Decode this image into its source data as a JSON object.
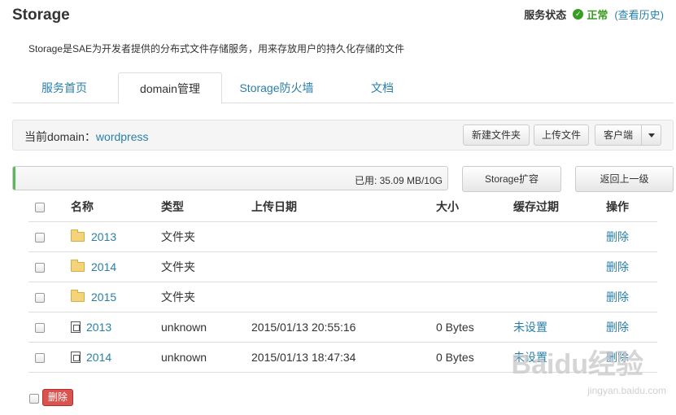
{
  "header": {
    "title": "Storage",
    "status_label": "服务状态",
    "status_value": "正常",
    "status_color": "#3a9d23",
    "history_link": "(查看历史)"
  },
  "description": "Storage是SAE为开发者提供的分布式文件存储服务，用来存放用户的持久化存储的文件",
  "tabs": [
    {
      "label": "服务首页",
      "active": false
    },
    {
      "label": "domain管理",
      "active": true
    },
    {
      "label": "Storage防火墙",
      "active": false
    },
    {
      "label": "文档",
      "active": false
    }
  ],
  "toolbar": {
    "current_label": "当前domain：",
    "current_value": "wordpress",
    "new_folder": "新建文件夹",
    "upload": "上传文件",
    "client": "客户端"
  },
  "usage": {
    "text": "已用: 35.09 MB/10G",
    "fraction": 0.0034,
    "expand_button": "Storage扩容",
    "back_button": "返回上一级"
  },
  "table": {
    "headers": [
      "名称",
      "类型",
      "上传日期",
      "大小",
      "缓存过期",
      "操作"
    ],
    "rows": [
      {
        "icon": "folder-icon",
        "name": "2013",
        "type": "文件夹",
        "date": "",
        "size": "",
        "cache": "",
        "action": "删除"
      },
      {
        "icon": "folder-icon",
        "name": "2014",
        "type": "文件夹",
        "date": "",
        "size": "",
        "cache": "",
        "action": "删除"
      },
      {
        "icon": "folder-icon",
        "name": "2015",
        "type": "文件夹",
        "date": "",
        "size": "",
        "cache": "",
        "action": "删除"
      },
      {
        "icon": "file-icon",
        "name": "2013",
        "type": "unknown",
        "date": "2015/01/13 20:55:16",
        "size": "0 Bytes",
        "cache": "未设置",
        "action": "删除"
      },
      {
        "icon": "file-icon",
        "name": "2014",
        "type": "unknown",
        "date": "2015/01/13 18:47:34",
        "size": "0 Bytes",
        "cache": "未设置",
        "action": "删除"
      }
    ]
  },
  "bulk_delete": "删除",
  "watermark": {
    "logo": "Baidu经验",
    "url": "jingyan.baidu.com"
  },
  "colors": {
    "link": "#2a7fa8",
    "danger": "#d9534f",
    "progress": "#5cb85c"
  }
}
